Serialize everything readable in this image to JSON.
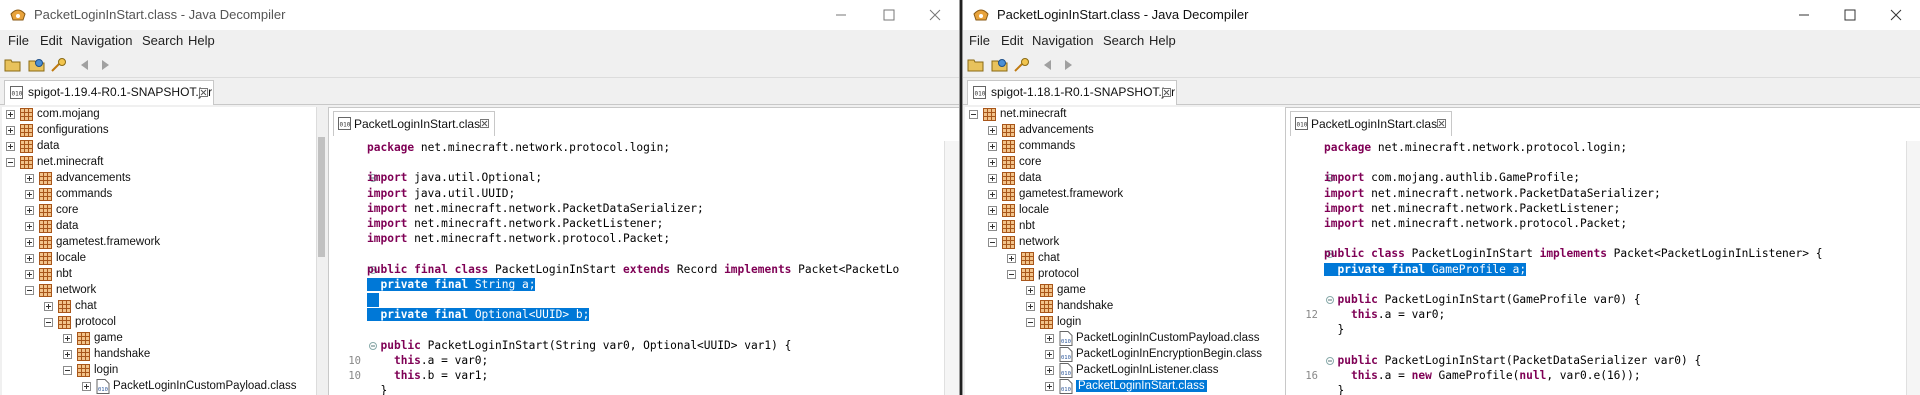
{
  "left": {
    "title": "PacketLoginInStart.class - Java Decompiler",
    "menu": [
      "File",
      "Edit",
      "Navigation",
      "Search",
      "Help"
    ],
    "jar_tab": "spigot-1.19.4-R0.1-SNAPSHOT.jar",
    "editor_tab": "PacketLoginInStart.class",
    "tree": [
      {
        "label": "com.mojang",
        "indent": 0,
        "exp": "plus",
        "icon": "pkg"
      },
      {
        "label": "configurations",
        "indent": 0,
        "exp": "plus",
        "icon": "pkg"
      },
      {
        "label": "data",
        "indent": 0,
        "exp": "plus",
        "icon": "pkg"
      },
      {
        "label": "net.minecraft",
        "indent": 0,
        "exp": "minus",
        "icon": "pkg"
      },
      {
        "label": "advancements",
        "indent": 1,
        "exp": "plus",
        "icon": "pkg"
      },
      {
        "label": "commands",
        "indent": 1,
        "exp": "plus",
        "icon": "pkg"
      },
      {
        "label": "core",
        "indent": 1,
        "exp": "plus",
        "icon": "pkg"
      },
      {
        "label": "data",
        "indent": 1,
        "exp": "plus",
        "icon": "pkg"
      },
      {
        "label": "gametest.framework",
        "indent": 1,
        "exp": "plus",
        "icon": "pkg"
      },
      {
        "label": "locale",
        "indent": 1,
        "exp": "plus",
        "icon": "pkg"
      },
      {
        "label": "nbt",
        "indent": 1,
        "exp": "plus",
        "icon": "pkg"
      },
      {
        "label": "network",
        "indent": 1,
        "exp": "minus",
        "icon": "pkg"
      },
      {
        "label": "chat",
        "indent": 2,
        "exp": "plus",
        "icon": "pkg"
      },
      {
        "label": "protocol",
        "indent": 2,
        "exp": "minus",
        "icon": "pkg"
      },
      {
        "label": "game",
        "indent": 3,
        "exp": "plus",
        "icon": "pkg"
      },
      {
        "label": "handshake",
        "indent": 3,
        "exp": "plus",
        "icon": "pkg"
      },
      {
        "label": "login",
        "indent": 3,
        "exp": "minus",
        "icon": "pkg"
      },
      {
        "label": "PacketLoginInCustomPayload.class",
        "indent": 4,
        "exp": "plus",
        "icon": "cls"
      }
    ],
    "code": [
      {
        "gut": "",
        "fold": false,
        "text": "package net.minecraft.network.protocol.login;"
      },
      {
        "gut": "",
        "fold": false,
        "text": ""
      },
      {
        "gut": "",
        "fold": true,
        "text": "import java.util.Optional;"
      },
      {
        "gut": "",
        "fold": false,
        "text": "import java.util.UUID;"
      },
      {
        "gut": "",
        "fold": false,
        "text": "import net.minecraft.network.PacketDataSerializer;"
      },
      {
        "gut": "",
        "fold": false,
        "text": "import net.minecraft.network.PacketListener;"
      },
      {
        "gut": "",
        "fold": false,
        "text": "import net.minecraft.network.protocol.Packet;"
      },
      {
        "gut": "",
        "fold": false,
        "text": ""
      },
      {
        "gut": "",
        "fold": true,
        "text": "public final class PacketLoginInStart extends Record implements Packet<PacketLo"
      },
      {
        "gut": "",
        "fold": false,
        "text": "  private final String a;",
        "hl": true
      },
      {
        "gut": "",
        "fold": false,
        "text": "",
        "hl": true
      },
      {
        "gut": "",
        "fold": false,
        "text": "  private final Optional<UUID> b;",
        "hl": true
      },
      {
        "gut": "",
        "fold": false,
        "text": ""
      },
      {
        "gut": "",
        "fold": true,
        "text": "  public PacketLoginInStart(String var0, Optional<UUID> var1) {"
      },
      {
        "gut": "10",
        "fold": false,
        "text": "    this.a = var0;"
      },
      {
        "gut": "10",
        "fold": false,
        "text": "    this.b = var1;"
      },
      {
        "gut": "",
        "fold": false,
        "text": "  }"
      }
    ]
  },
  "right": {
    "title": "PacketLoginInStart.class - Java Decompiler",
    "menu": [
      "File",
      "Edit",
      "Navigation",
      "Search",
      "Help"
    ],
    "jar_tab": "spigot-1.18.1-R0.1-SNAPSHOT.jar",
    "editor_tab": "PacketLoginInStart.class",
    "tree": [
      {
        "label": "net.minecraft",
        "indent": 0,
        "exp": "minus",
        "icon": "pkg"
      },
      {
        "label": "advancements",
        "indent": 1,
        "exp": "plus",
        "icon": "pkg"
      },
      {
        "label": "commands",
        "indent": 1,
        "exp": "plus",
        "icon": "pkg"
      },
      {
        "label": "core",
        "indent": 1,
        "exp": "plus",
        "icon": "pkg"
      },
      {
        "label": "data",
        "indent": 1,
        "exp": "plus",
        "icon": "pkg"
      },
      {
        "label": "gametest.framework",
        "indent": 1,
        "exp": "plus",
        "icon": "pkg"
      },
      {
        "label": "locale",
        "indent": 1,
        "exp": "plus",
        "icon": "pkg"
      },
      {
        "label": "nbt",
        "indent": 1,
        "exp": "plus",
        "icon": "pkg"
      },
      {
        "label": "network",
        "indent": 1,
        "exp": "minus",
        "icon": "pkg"
      },
      {
        "label": "chat",
        "indent": 2,
        "exp": "plus",
        "icon": "pkg"
      },
      {
        "label": "protocol",
        "indent": 2,
        "exp": "minus",
        "icon": "pkg"
      },
      {
        "label": "game",
        "indent": 3,
        "exp": "plus",
        "icon": "pkg"
      },
      {
        "label": "handshake",
        "indent": 3,
        "exp": "plus",
        "icon": "pkg"
      },
      {
        "label": "login",
        "indent": 3,
        "exp": "minus",
        "icon": "pkg"
      },
      {
        "label": "PacketLoginInCustomPayload.class",
        "indent": 4,
        "exp": "plus",
        "icon": "cls"
      },
      {
        "label": "PacketLoginInEncryptionBegin.class",
        "indent": 4,
        "exp": "plus",
        "icon": "cls"
      },
      {
        "label": "PacketLoginInListener.class",
        "indent": 4,
        "exp": "plus",
        "icon": "cls"
      },
      {
        "label": "PacketLoginInStart.class",
        "indent": 4,
        "exp": "plus",
        "icon": "cls",
        "selected": true
      }
    ],
    "code": [
      {
        "gut": "",
        "fold": false,
        "text": "package net.minecraft.network.protocol.login;"
      },
      {
        "gut": "",
        "fold": false,
        "text": ""
      },
      {
        "gut": "",
        "fold": true,
        "text": "import com.mojang.authlib.GameProfile;"
      },
      {
        "gut": "",
        "fold": false,
        "text": "import net.minecraft.network.PacketDataSerializer;"
      },
      {
        "gut": "",
        "fold": false,
        "text": "import net.minecraft.network.PacketListener;"
      },
      {
        "gut": "",
        "fold": false,
        "text": "import net.minecraft.network.protocol.Packet;"
      },
      {
        "gut": "",
        "fold": false,
        "text": ""
      },
      {
        "gut": "",
        "fold": true,
        "text": "public class PacketLoginInStart implements Packet<PacketLoginInListener> {"
      },
      {
        "gut": "",
        "fold": false,
        "text": "  private final GameProfile a;",
        "hl": true
      },
      {
        "gut": "",
        "fold": false,
        "text": ""
      },
      {
        "gut": "",
        "fold": true,
        "text": "  public PacketLoginInStart(GameProfile var0) {"
      },
      {
        "gut": "12",
        "fold": false,
        "text": "    this.a = var0;"
      },
      {
        "gut": "",
        "fold": false,
        "text": "  }"
      },
      {
        "gut": "",
        "fold": false,
        "text": ""
      },
      {
        "gut": "",
        "fold": true,
        "text": "  public PacketLoginInStart(PacketDataSerializer var0) {"
      },
      {
        "gut": "16",
        "fold": false,
        "text": "    this.a = new GameProfile(null, var0.e(16));"
      },
      {
        "gut": "",
        "fold": false,
        "text": "  }"
      }
    ]
  },
  "colors": {
    "selection": "#0078d7",
    "keyword": "#7f0055",
    "package_icon": "#c06a1b"
  },
  "icons": [
    "app-icon",
    "open-file-icon",
    "open-type-icon",
    "search-type-icon",
    "back-icon",
    "forward-icon",
    "minimize-icon",
    "maximize-icon",
    "close-icon",
    "tab-close-icon",
    "jar-icon",
    "class-file-icon",
    "package-icon"
  ]
}
